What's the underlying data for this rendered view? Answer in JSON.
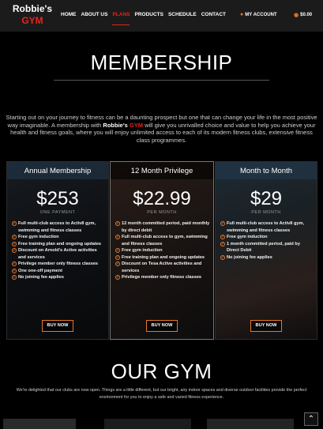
{
  "header": {
    "logo": {
      "line1": "Robbie's",
      "line2": "GYM"
    },
    "menu": [
      {
        "label": "HOME"
      },
      {
        "label": "ABOUT US"
      },
      {
        "label": "PLANS"
      },
      {
        "label": "PRODUCTS"
      },
      {
        "label": "SCHEDULE"
      },
      {
        "label": "CONTACT"
      }
    ],
    "account_label": "MY ACCOUNT",
    "cart_total": "$0.00"
  },
  "membership": {
    "title": "MEMBERSHIP",
    "intro_part1": "Starting out on your journey to fitness can be a daunting prospect but one that can change your life in the most positive way imaginable. A membership with ",
    "intro_brand": "Robbie's",
    "intro_brand_red": "GYM",
    "intro_part2": " will give you unrivalled choice and value to help you achieve your health and fitness goals, where you will enjoy unlimited access to each of its modern fitness clubs, extensive fitness class programmes."
  },
  "plans": [
    {
      "name": "Annual Membership",
      "price": "$253",
      "period": "ONE PAYMENT",
      "features": [
        "Full multi-club access to Activ8 gym, swimming and fitness classes",
        "Free gym induction",
        "Free training plan and ongoing updates",
        "Discount on Arnold's Active activities and services",
        "Privilege member only fitness classes",
        "One one-off payment",
        "No joining fee applies"
      ],
      "button": "BUY NOW"
    },
    {
      "name": "12 Month Privilege",
      "price": "$22.99",
      "period": "PER MONTH",
      "features": [
        "12 month committed period, paid monthly by direct debit",
        "Full multi-club access to gym, swimming and fitness classes",
        "Free gym induction",
        "Free training plan and ongoing updates",
        "Discount on Tesa Active activities and services",
        "Privilege member only fitness classes"
      ],
      "button": "BUY NOW"
    },
    {
      "name": "Month to Month",
      "price": "$29",
      "period": "PER MONTH",
      "features": [
        "Full multi-club access to Activ8 gym, swimming and fitness classes",
        "Free gym induction",
        "1 month committed period, paid by Direct Debit",
        "No joining fee applies"
      ],
      "button": "BUY NOW"
    }
  ],
  "our_gym": {
    "title": "OUR GYM",
    "text": "We're delighted that our clubs are now open. Things are a little different, but our bright, airy indoor spaces and diverse outdoor facilities provide the perfect environment for you to enjoy a safe and varied fitness experience."
  },
  "scroll_top_icon": "chevron-up-icon",
  "colors": {
    "accent_red": "#e3261c",
    "accent_orange": "#e8772a",
    "background": "#000000"
  }
}
